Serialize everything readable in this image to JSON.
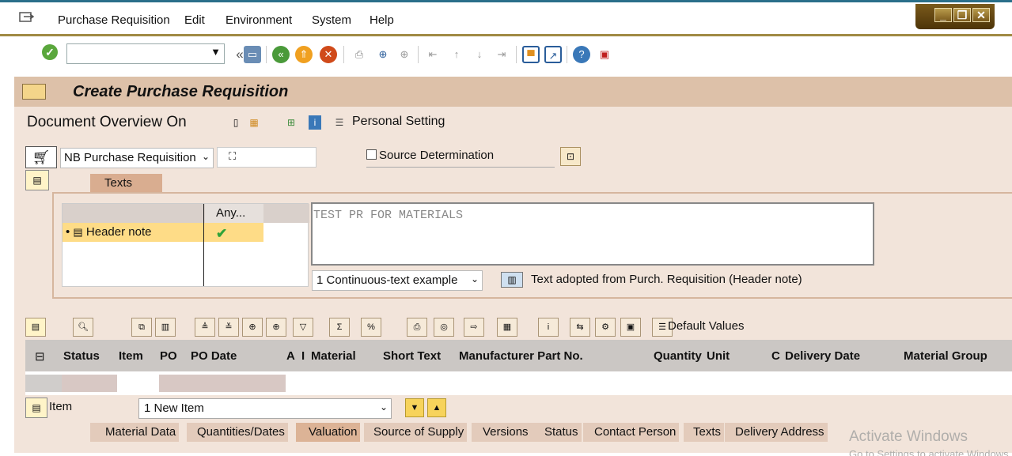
{
  "menu": {
    "items": [
      {
        "label": "Purchase Requisition"
      },
      {
        "label": "Edit"
      },
      {
        "label": "Environment"
      },
      {
        "label": "System"
      },
      {
        "label": "Help"
      }
    ]
  },
  "window_controls": {
    "minimize": "_",
    "restore": "❐",
    "close": "✕"
  },
  "toolbar": {
    "command_field_value": "",
    "icons": [
      "enter-icon",
      "save-icon",
      "back-icon",
      "exit-icon",
      "cancel-icon",
      "print-icon",
      "find-icon",
      "find-next-icon",
      "first-page-icon",
      "previous-page-icon",
      "next-page-icon",
      "last-page-icon",
      "new-session-icon",
      "shortcut-icon",
      "help-icon",
      "layout-icon"
    ]
  },
  "title": {
    "text": "Create Purchase Requisition"
  },
  "doc_overview": {
    "label": "Document Overview On",
    "personal_setting": "Personal Setting"
  },
  "header": {
    "doc_type": "NB Purchase Requisition",
    "doc_number": "⛶",
    "source_determination": "Source Determination",
    "source_determination_checked": false
  },
  "texts": {
    "tab_label": "Texts",
    "column_any": "Any...",
    "rows": [
      {
        "label": "Header note",
        "has_text": true
      }
    ],
    "editor_text": "TEST PR FOR MATERIALS",
    "format": "1 Continuous-text example",
    "adopted_text": "Text adopted from Purch. Requisition (Header note)"
  },
  "items": {
    "default_values": "Default Values",
    "columns": [
      "Status",
      "Item",
      "PO",
      "PO Date",
      "A",
      "I",
      "Material",
      "Short Text",
      "Manufacturer Part No.",
      "Quantity",
      "Unit",
      "C",
      "Delivery Date",
      "Material Group"
    ],
    "rows": []
  },
  "item_detail": {
    "label": "Item",
    "selected_item": "1 New Item",
    "tabs": [
      "Material Data",
      "Quantities/Dates",
      "Valuation",
      "Source of Supply",
      "Versions",
      "Status",
      "Contact Person",
      "Texts",
      "Delivery Address"
    ],
    "active_tab": "Valuation"
  },
  "watermark": {
    "line1": "Activate Windows",
    "line2": "Go to Settings to activate Windows."
  },
  "colors": {
    "title_bar": "#ddc1a9",
    "app_background": "#f2e4da",
    "menu_border_gold": "#a08a44",
    "selected_row": "#fedc87",
    "grid_header": "#cbc7c4"
  }
}
